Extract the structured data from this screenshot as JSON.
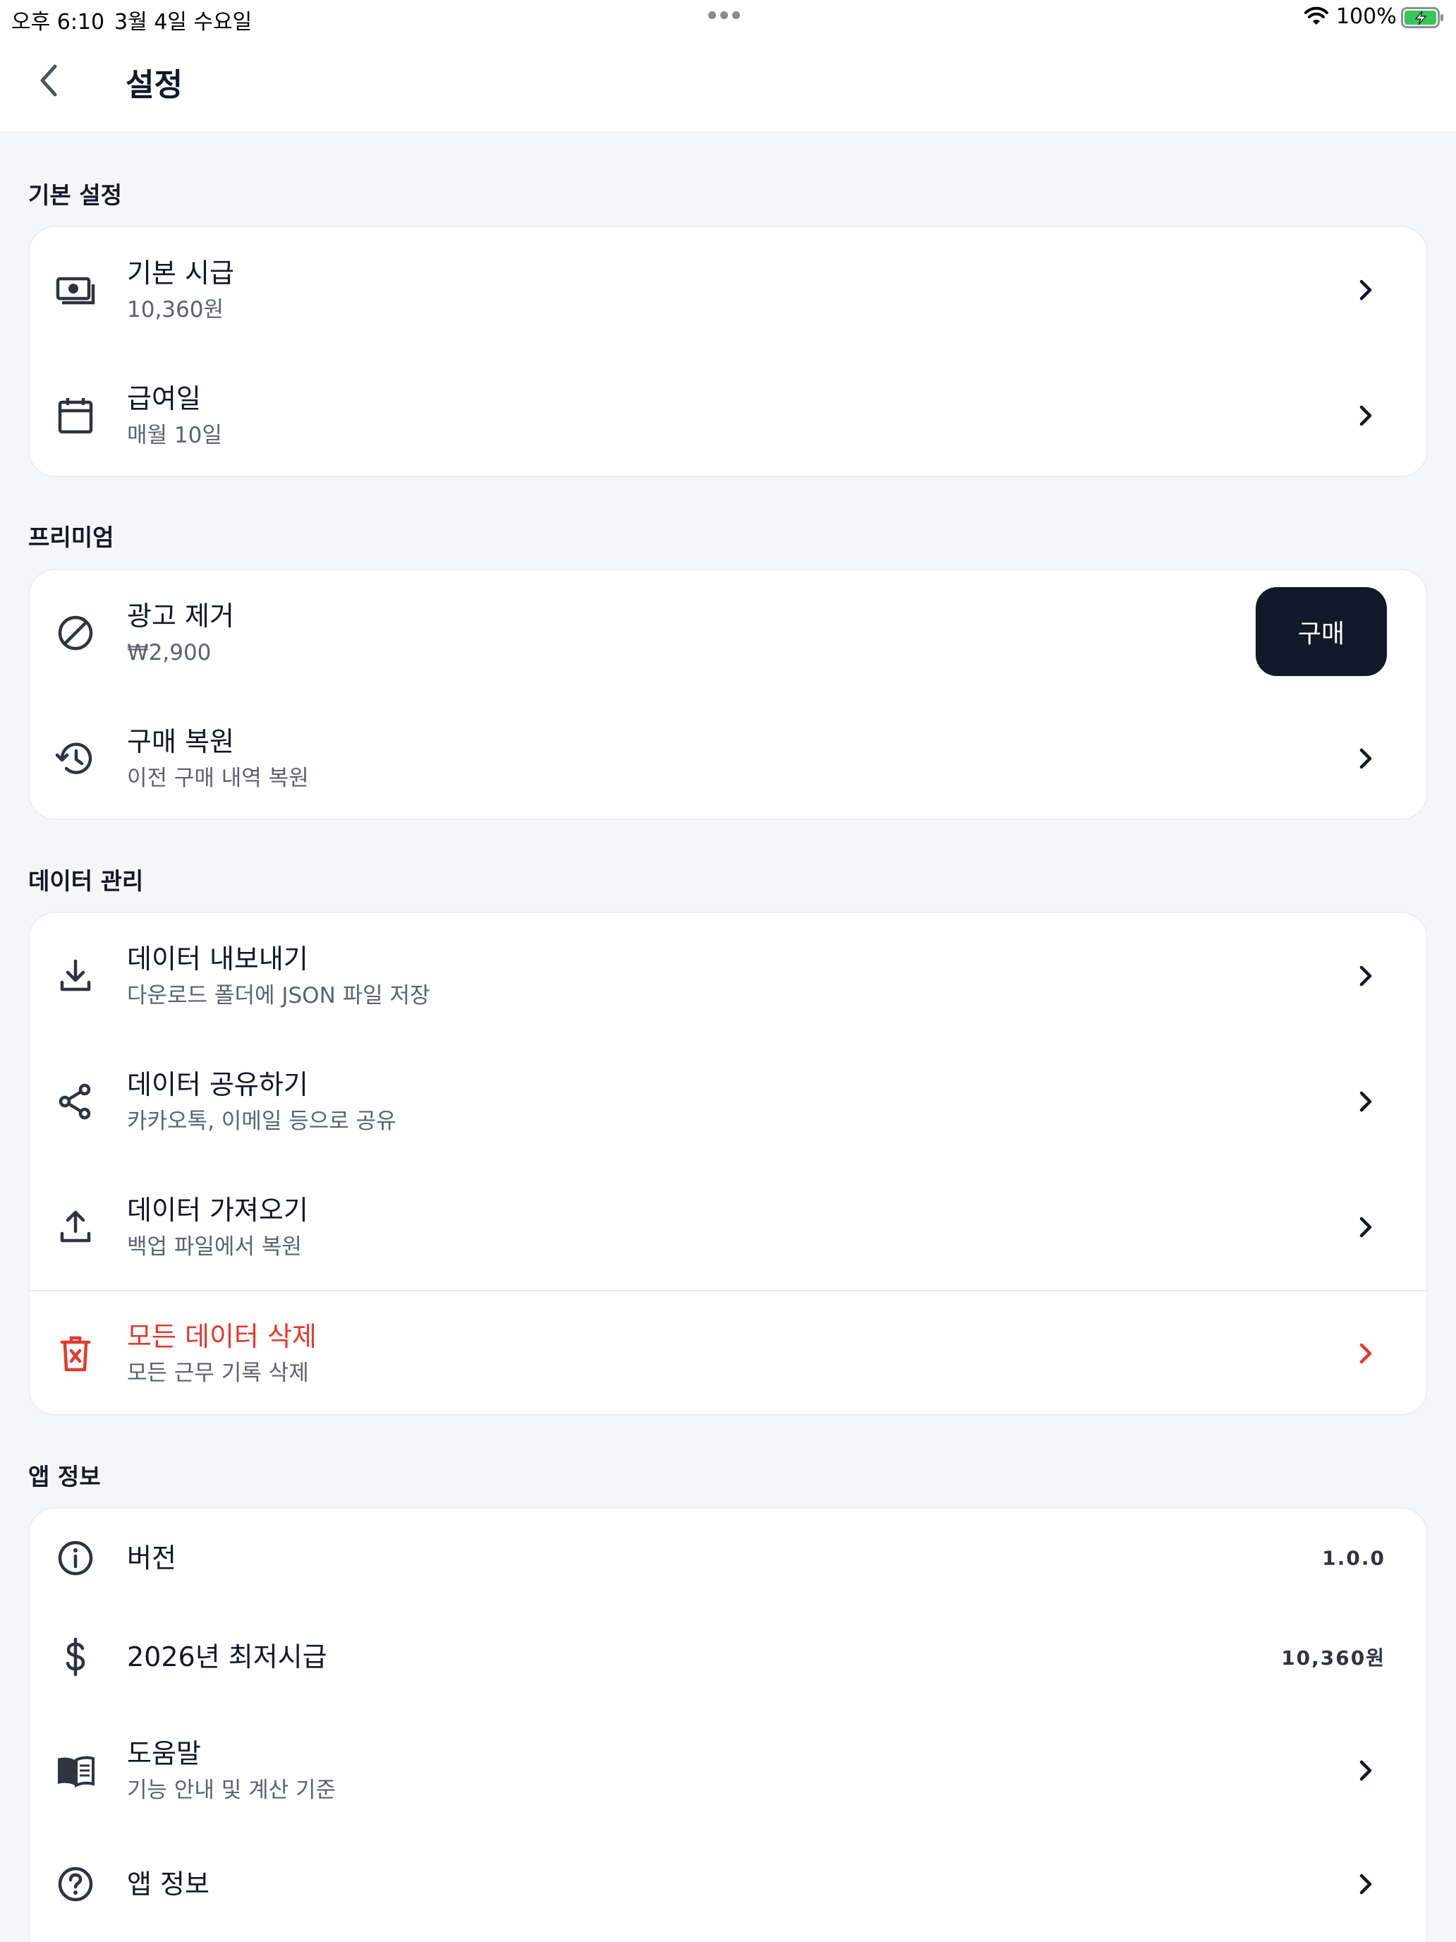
{
  "status_bar": {
    "time": "오후 6:10",
    "date": "3월 4일 수요일",
    "battery": "100%"
  },
  "header": {
    "title": "설정"
  },
  "sections": {
    "basic": {
      "title": "기본 설정",
      "items": [
        {
          "title": "기본 시급",
          "subtitle": "10,360원",
          "icon": "money-icon"
        },
        {
          "title": "급여일",
          "subtitle": "매월 10일",
          "icon": "calendar-icon"
        }
      ]
    },
    "premium": {
      "title": "프리미엄",
      "items": [
        {
          "title": "광고 제거",
          "subtitle": "₩2,900",
          "icon": "block-icon",
          "button": "구매"
        },
        {
          "title": "구매 복원",
          "subtitle": "이전 구매 내역 복원",
          "icon": "history-icon"
        }
      ]
    },
    "data": {
      "title": "데이터 관리",
      "items": [
        {
          "title": "데이터 내보내기",
          "subtitle": "다운로드 폴더에 JSON 파일 저장",
          "icon": "download-icon"
        },
        {
          "title": "데이터 공유하기",
          "subtitle": "카카오톡, 이메일 등으로 공유",
          "icon": "share-icon"
        },
        {
          "title": "데이터 가져오기",
          "subtitle": "백업 파일에서 복원",
          "icon": "upload-icon"
        },
        {
          "title": "모든 데이터 삭제",
          "subtitle": "모든 근무 기록 삭제",
          "icon": "trash-icon"
        }
      ]
    },
    "app": {
      "title": "앱 정보",
      "items": [
        {
          "title": "버전",
          "value": "1.0.0",
          "icon": "info-icon"
        },
        {
          "title": "2026년 최저시급",
          "value": "10,360원",
          "icon": "dollar-icon"
        },
        {
          "title": "도움말",
          "subtitle": "기능 안내 및 계산 기준",
          "icon": "book-icon"
        },
        {
          "title": "앱 정보",
          "icon": "help-icon"
        }
      ]
    }
  },
  "colors": {
    "background": "#f5f6f8",
    "card": "#ffffff",
    "text": "#111827",
    "subtext": "#5b6270",
    "danger": "#e5392f",
    "button": "#111827",
    "battery": "#34c759"
  }
}
